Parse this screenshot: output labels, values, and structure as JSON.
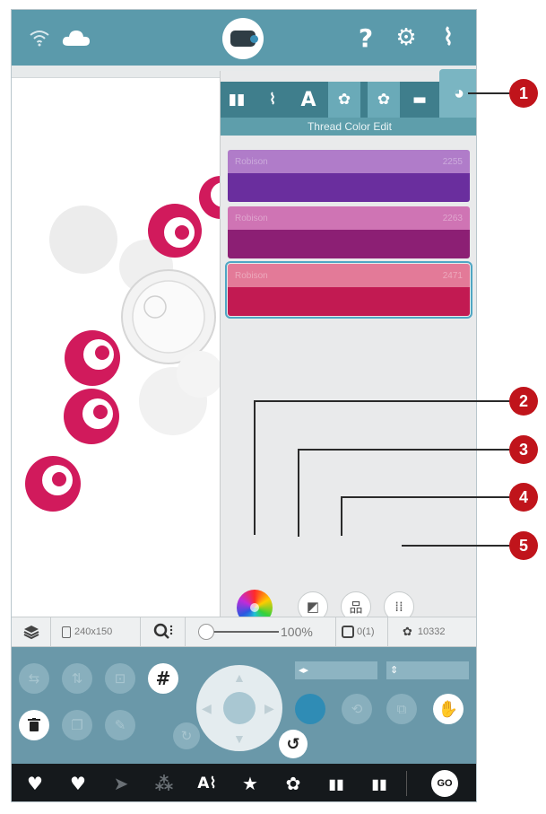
{
  "top_bar": {
    "icons": [
      "wifi-icon",
      "cloud-icon",
      "machine-icon",
      "help-icon",
      "settings-icon",
      "stitch-icon"
    ],
    "help_glyph": "?",
    "settings_glyph": "⚙",
    "stitch_glyph": "⌇"
  },
  "panel": {
    "tabs": [
      {
        "name": "book-tab",
        "glyph": "▮▮"
      },
      {
        "name": "stitch-tab",
        "glyph": "⌇"
      },
      {
        "name": "font-tab",
        "glyph": "A"
      },
      {
        "name": "flower-tab",
        "glyph": "✿"
      },
      {
        "name": "design-tab",
        "glyph": "✿"
      },
      {
        "name": "folder-tab",
        "glyph": "▬"
      },
      {
        "name": "palette-tab",
        "glyph": "◕"
      }
    ],
    "title": "Thread Color Edit",
    "threads": [
      {
        "label": "Robison",
        "code": "2255",
        "light": "#b07cc9",
        "dark": "#6a2e9e"
      },
      {
        "label": "Robison",
        "code": "2263",
        "light": "#cf74b4",
        "dark": "#8c1f74"
      },
      {
        "label": "Robison",
        "code": "2471",
        "light": "#e37a98",
        "dark": "#c21a52"
      }
    ],
    "tools": [
      {
        "name": "color-wheel",
        "glyph": ""
      },
      {
        "name": "color-replace-button",
        "glyph": "◩"
      },
      {
        "name": "color-group-button",
        "glyph": "品"
      },
      {
        "name": "color-sort-button",
        "glyph": "⁞⁞"
      }
    ],
    "collapse_glyph": "^"
  },
  "status": {
    "hoop": "240x150",
    "zoom": "100%",
    "colors": "0(1)",
    "stitches": "10332"
  },
  "controls": {
    "move_glyph": "✥",
    "undo_glyph": "↺",
    "hand_glyph": "✋",
    "grid_glyph": "#",
    "delete_glyph": "🗑",
    "field1": "◂▸",
    "field2": "⇕"
  },
  "bottom_bar": {
    "items": [
      {
        "name": "favorite-icon",
        "glyph": "♥",
        "dim": false
      },
      {
        "name": "favorite-add-icon",
        "glyph": "♥",
        "dim": false
      },
      {
        "name": "send-icon",
        "glyph": "➤",
        "dim": true
      },
      {
        "name": "shape-icon",
        "glyph": "⁂",
        "dim": true
      },
      {
        "name": "text-stitch-icon",
        "glyph": "A⌇",
        "dim": false
      },
      {
        "name": "star-add-icon",
        "glyph": "★",
        "dim": false
      },
      {
        "name": "flower-icon",
        "glyph": "✿",
        "dim": false
      },
      {
        "name": "book-icon",
        "glyph": "▮▮",
        "dim": false
      },
      {
        "name": "book-search-icon",
        "glyph": "▮▮",
        "dim": false
      },
      {
        "name": "go-button",
        "glyph": "GO",
        "dim": false
      }
    ]
  },
  "callouts": [
    "1",
    "2",
    "3",
    "4",
    "5"
  ],
  "colors": {
    "accent": "#5b9aab",
    "design_pink": "#d11a5c",
    "badge": "#c0141b"
  }
}
